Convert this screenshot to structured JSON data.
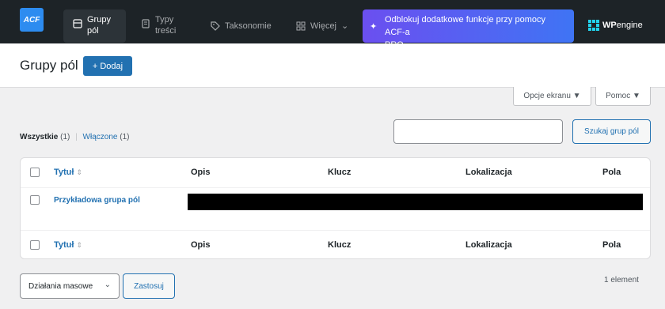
{
  "topnav": {
    "logo": "ACF",
    "items": [
      {
        "line1": "Grupy",
        "line2": "pól",
        "icon": "field-groups-icon"
      },
      {
        "line1": "Typy",
        "line2": "treści",
        "icon": "post-types-icon"
      },
      {
        "label": "Taksonomie",
        "icon": "tag-icon"
      },
      {
        "label": "Więcej",
        "icon": "grid-icon"
      }
    ],
    "promo": {
      "line1": "Odblokuj dodatkowe funkcje przy pomocy ACF-a",
      "line2": "PRO"
    },
    "wpengine": {
      "wp": "WP",
      "engine": "engine"
    }
  },
  "header": {
    "title": "Grupy pól",
    "add_label": "+ Dodaj"
  },
  "screen_options": {
    "options_label": "Opcje ekranu ▼",
    "help_label": "Pomoc ▼"
  },
  "filters": {
    "all": "Wszystkie",
    "all_count": "(1)",
    "sep": "|",
    "enabled": "Włączone",
    "enabled_count": "(1)"
  },
  "search": {
    "placeholder": "",
    "button": "Szukaj grup pól"
  },
  "table": {
    "columns": [
      "Tytuł",
      "Opis",
      "Klucz",
      "Lokalizacja",
      "Pola"
    ],
    "rows": [
      {
        "title": "Przykładowa grupa pól"
      }
    ]
  },
  "bulk": {
    "select": "Działania masowe",
    "apply": "Zastosuj",
    "count": "1 element"
  },
  "colors": {
    "accent": "#2271b1",
    "topbar": "#1d2327",
    "promo_start": "#6b4ff0",
    "promo_end": "#3f74f4"
  }
}
